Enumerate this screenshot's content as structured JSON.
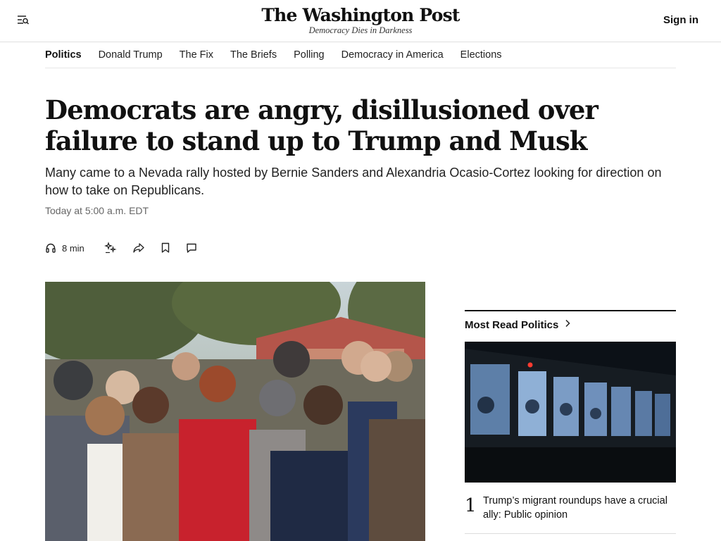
{
  "header": {
    "logo_name": "The Washington Post",
    "logo_tagline": "Democracy Dies in Darkness",
    "signin_label": "Sign in",
    "menu_icon": "menu-search-icon"
  },
  "section_nav": {
    "items": [
      {
        "label": "Politics",
        "active": true
      },
      {
        "label": "Donald Trump",
        "active": false
      },
      {
        "label": "The Fix",
        "active": false
      },
      {
        "label": "The Briefs",
        "active": false
      },
      {
        "label": "Polling",
        "active": false
      },
      {
        "label": "Democracy in America",
        "active": false
      },
      {
        "label": "Elections",
        "active": false
      }
    ]
  },
  "article": {
    "headline": "Democrats are angry, disillusioned over failure to stand up to Trump and Musk",
    "dek": "Many came to a Nevada rally hosted by Bernie Sanders and Alexandria Ocasio-Cortez looking for direction on how to take on Republicans.",
    "timestamp": "Today at 5:00 a.m. EDT",
    "toolbar": {
      "listen_label": "8 min",
      "icons": [
        "headphones-icon",
        "sparkle-icon",
        "share-icon",
        "bookmark-icon",
        "comment-icon"
      ]
    }
  },
  "sidebar": {
    "most_read_title": "Most Read Politics",
    "stories": [
      {
        "rank": "1",
        "title": "Trump’s migrant roundups have a crucial ally: Public opinion"
      }
    ]
  },
  "colors": {
    "text": "#111111",
    "muted": "#666666",
    "rule": "#e0e0e0"
  }
}
